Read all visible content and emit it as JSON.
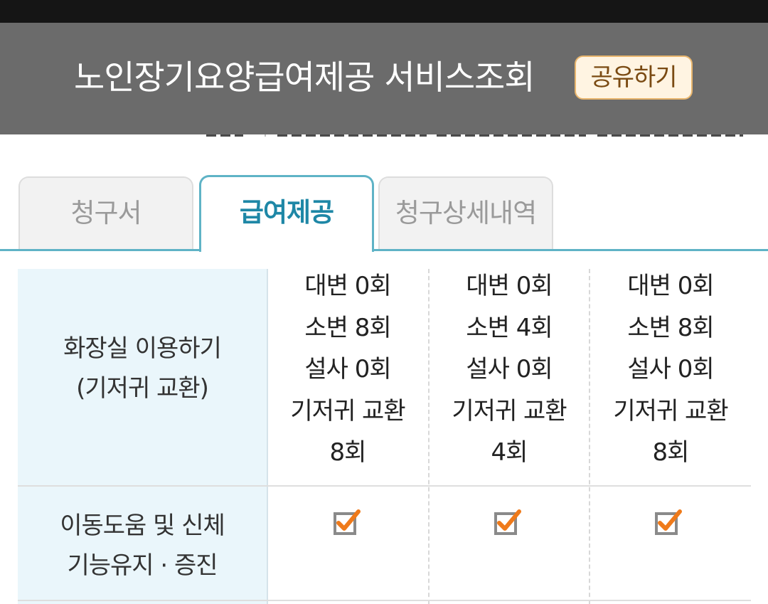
{
  "header": {
    "title": "노인장기요양급여제공 서비스조회",
    "share_label": "공유하기"
  },
  "tabs": [
    {
      "label": "청구서",
      "active": false
    },
    {
      "label": "급여제공",
      "active": true
    },
    {
      "label": "청구상세내역",
      "active": false
    }
  ],
  "table": {
    "rows": [
      {
        "label_lines": [
          "화장실 이용하기",
          "(기저귀 교환)"
        ],
        "cells": [
          [
            "대변 0회",
            "소변 8회",
            "설사 0회",
            "기저귀 교환",
            "8회"
          ],
          [
            "대변 0회",
            "소변 4회",
            "설사 0회",
            "기저귀 교환",
            "4회"
          ],
          [
            "대변 0회",
            "소변 8회",
            "설사 0회",
            "기저귀 교환",
            "8회"
          ]
        ]
      },
      {
        "label_lines": [
          "이동도움 및 신체",
          "기능유지 · 증진"
        ],
        "checked": [
          true,
          true,
          true
        ]
      }
    ]
  },
  "colors": {
    "header_bg": "#6b6b6b",
    "accent": "#1e87a6",
    "tab_border": "#5fb3c6",
    "label_col_bg": "#eaf6fb",
    "check_orange": "#ef7a1a",
    "share_bg": "#fff4e2"
  },
  "icons": {
    "checkbox": "checked-checkbox-icon"
  }
}
